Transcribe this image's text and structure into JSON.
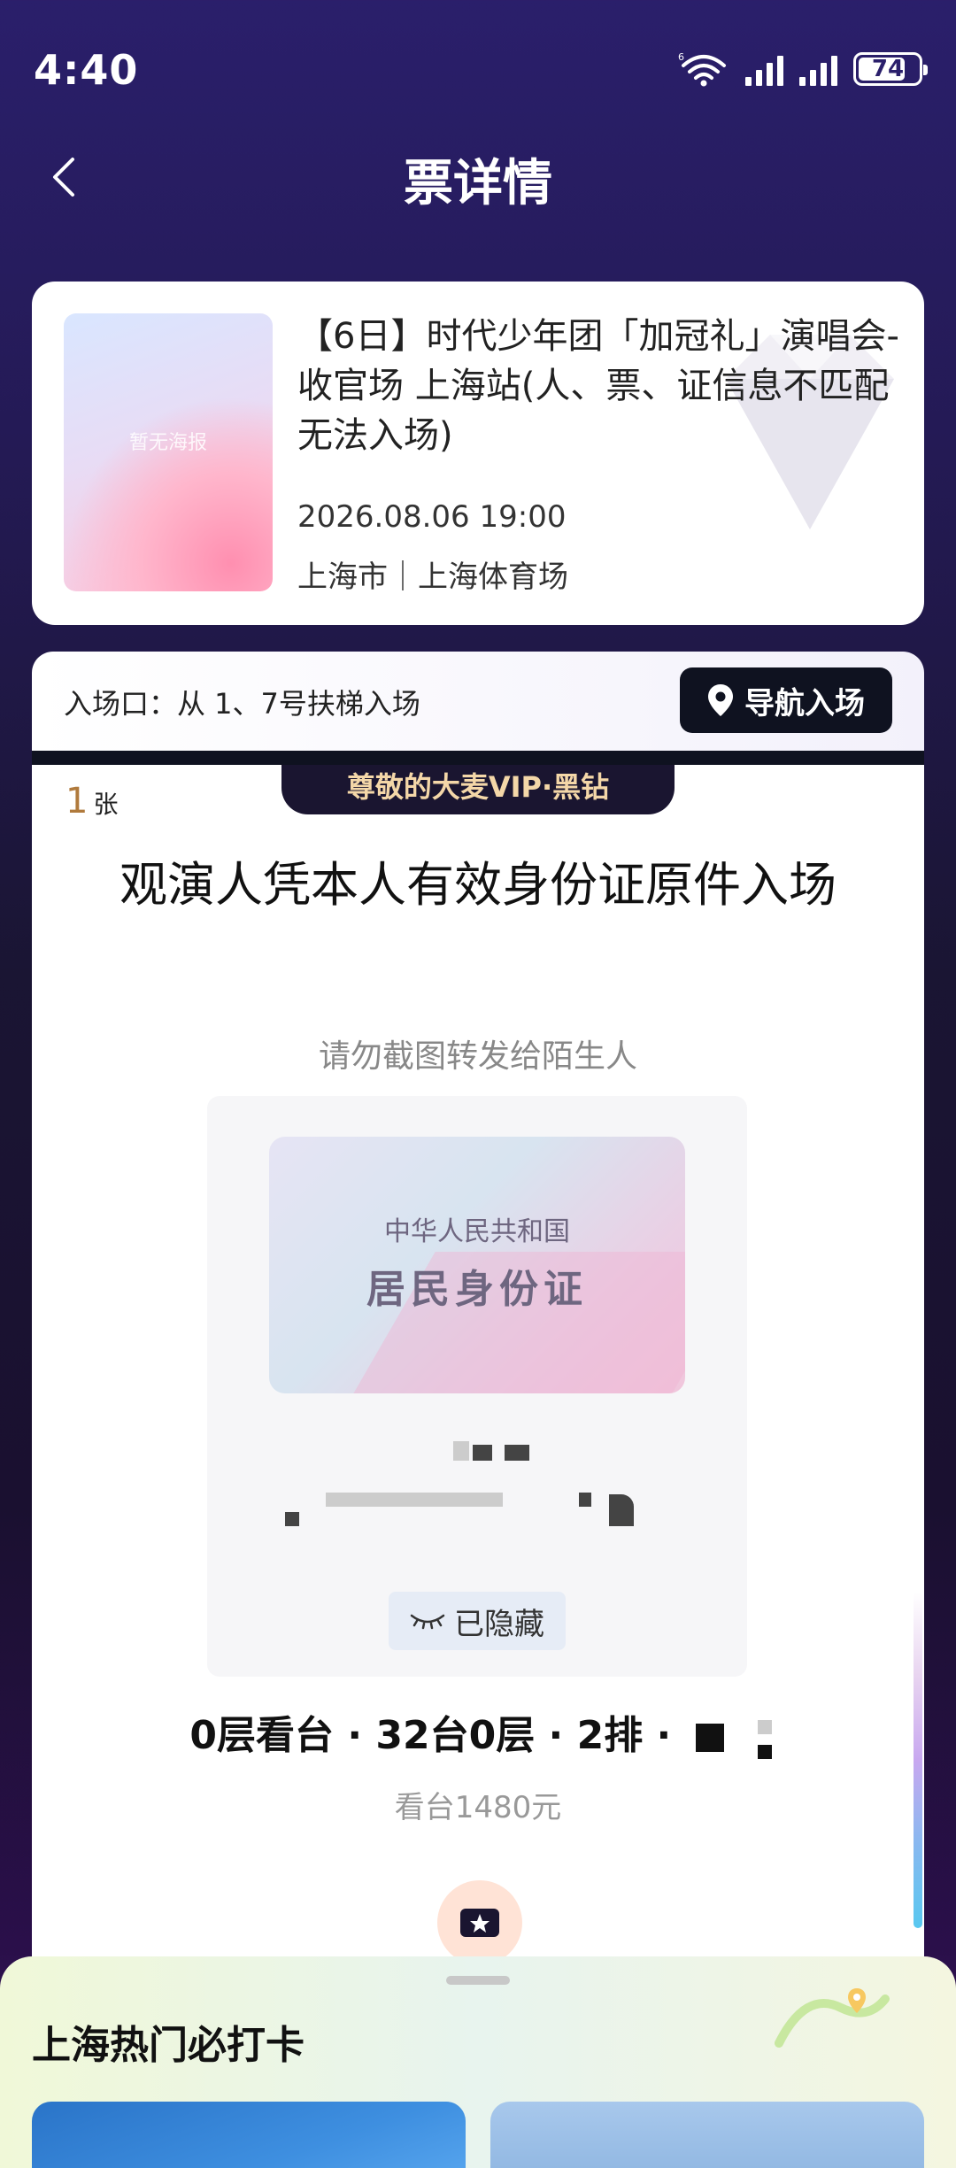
{
  "status_bar": {
    "time": "4:40",
    "battery": "74"
  },
  "header": {
    "title": "票详情"
  },
  "event": {
    "poster_placeholder": "暂无海报",
    "name": "【6日】时代少年团「加冠礼」演唱会-收官场 上海站(人、票、证信息不匹配无法入场)",
    "datetime": "2026.08.06 19:00",
    "venue": "上海市｜上海体育场"
  },
  "entrance": {
    "text": "入场口：从 1、7号扶梯入场",
    "nav_label": "导航入场"
  },
  "ticket": {
    "vip_label": "尊敬的大麦VIP·黑钻",
    "count": "1",
    "count_unit": "张",
    "instruction": "观演人凭本人有效身份证原件入场",
    "warning": "请勿截图转发给陌生人",
    "id_card_line1": "中华人民共和国",
    "id_card_line2": "居民身份证",
    "hidden_label": "已隐藏",
    "seat": "0层看台 · 32台0层 · 2排 ·",
    "price": "看台1480元"
  },
  "bottom_sheet": {
    "title": "上海热门必打卡"
  }
}
